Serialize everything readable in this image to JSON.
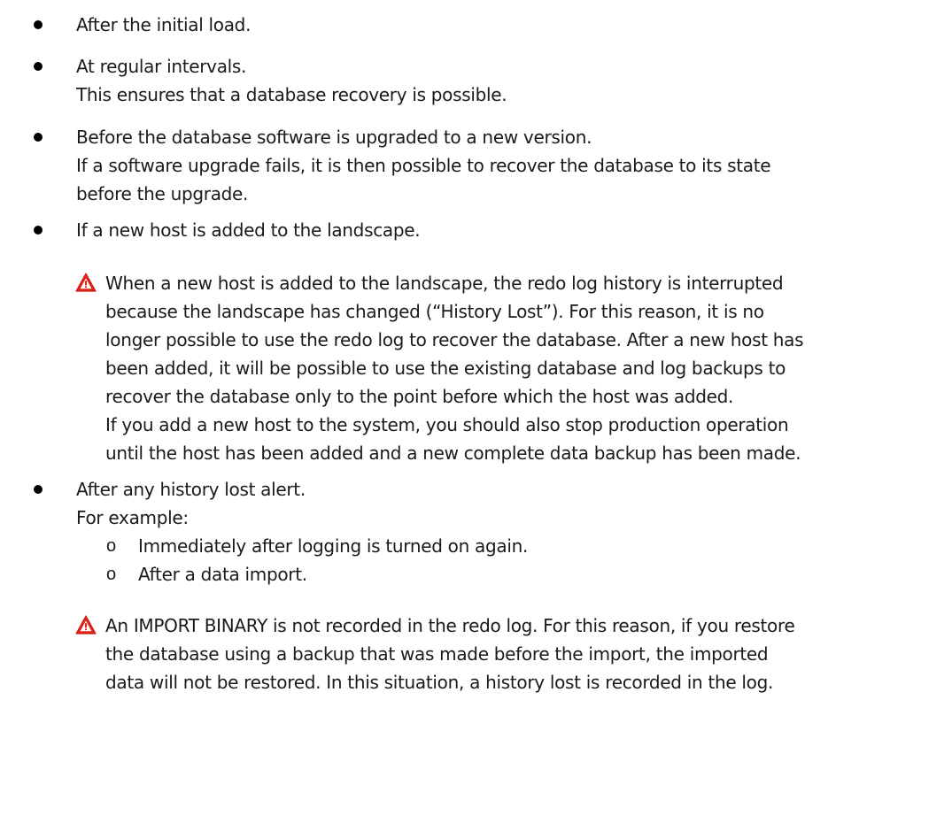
{
  "bullets": {
    "b1": "After the initial load.",
    "b2": "At regular intervals.",
    "b2_note": "This ensures that a database recovery is possible.",
    "b3": "Before the database software is upgraded to a new version.",
    "b3_note_1": "If a software upgrade fails, it is then possible to recover the database to its state",
    "b3_note_2": "before the upgrade.",
    "b4": "If a new host is added to the landscape.",
    "b5": "After any history lost alert.",
    "b5_note": "For example:"
  },
  "warning_1": {
    "icon": "warning-triangle-icon",
    "lines": [
      "When a new host is added to the landscape, the redo log history is interrupted",
      "because the landscape has changed (“History Lost”). For this reason, it is no",
      "longer possible to use the redo log to recover the database. After a new host has",
      "been added, it will be possible to use the existing database and log backups to",
      "recover the database only to the point before which the host was added.",
      "If you add a new host to the system, you should also stop production operation",
      "until the host has been added and a new complete data backup has been made."
    ]
  },
  "sub_items": {
    "marker": "o",
    "items": [
      "Immediately after logging is turned on again.",
      "After a data import."
    ]
  },
  "warning_2": {
    "icon": "warning-triangle-icon",
    "lines": [
      "An IMPORT BINARY is not recorded in the redo log. For this reason, if you restore",
      "the database using a backup that was made before the import, the imported",
      "data will not be restored. In this situation, a history lost is recorded in the log."
    ]
  },
  "colors": {
    "text": "#1a1a1a",
    "warning_red": "#e2231a",
    "warning_border": "#c81e14"
  }
}
